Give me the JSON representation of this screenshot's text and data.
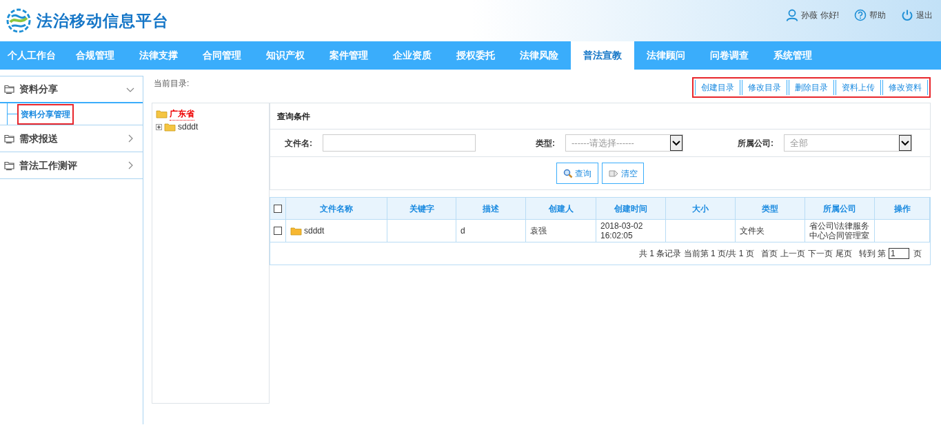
{
  "header": {
    "title": "法治移动信息平台",
    "user": "孙薇 你好!",
    "help": "帮助",
    "logout": "退出"
  },
  "nav": [
    {
      "label": "个人工作台",
      "selected": false
    },
    {
      "label": "合规管理",
      "selected": false
    },
    {
      "label": "法律支撑",
      "selected": false
    },
    {
      "label": "合同管理",
      "selected": false
    },
    {
      "label": "知识产权",
      "selected": false
    },
    {
      "label": "案件管理",
      "selected": false
    },
    {
      "label": "企业资质",
      "selected": false
    },
    {
      "label": "授权委托",
      "selected": false
    },
    {
      "label": "法律风险",
      "selected": false
    },
    {
      "label": "普法宣教",
      "selected": true
    },
    {
      "label": "法律顾问",
      "selected": false
    },
    {
      "label": "问卷调查",
      "selected": false
    },
    {
      "label": "系统管理",
      "selected": false
    }
  ],
  "sidebar": [
    {
      "label": "资料分享",
      "expanded": true,
      "children": [
        {
          "label": "资料分享管理",
          "selected": true,
          "highlighted": true
        }
      ]
    },
    {
      "label": "需求报送",
      "expanded": false
    },
    {
      "label": "普法工作测评",
      "expanded": false
    }
  ],
  "current_dir_label": "当前目录:",
  "tree": {
    "label": "广东省",
    "children": [
      {
        "label": "sdddt"
      }
    ]
  },
  "toolbar": {
    "highlighted": true,
    "buttons": [
      "创建目录",
      "修改目录",
      "删除目录",
      "资料上传",
      "修改资料"
    ]
  },
  "query": {
    "title": "查询条件",
    "fields": [
      {
        "kind": "text",
        "label": "文件名:"
      },
      {
        "kind": "select",
        "label": "类型:",
        "value": "------请选择------"
      },
      {
        "kind": "select",
        "label": "所属公司:",
        "value": "全部"
      }
    ],
    "search": "查询",
    "clear": "清空"
  },
  "table": {
    "columns": [
      "文件名称",
      "关键字",
      "描述",
      "创建人",
      "创建时间",
      "大小",
      "类型",
      "所属公司",
      "操作"
    ],
    "rows": [
      {
        "checked": false,
        "cells": [
          "sdddt",
          "",
          "d",
          "袁强",
          "2018-03-02 16:02:05",
          "",
          "文件夹",
          "省公司\\法律服务中心\\合同管理室",
          ""
        ]
      }
    ],
    "header_checked": false
  },
  "pager": {
    "summary": "共 1 条记录 当前第 1 页/共 1 页",
    "links": [
      "首页",
      "上一页",
      "下一页",
      "尾页"
    ],
    "goto": "转到 第",
    "page": "1",
    "unit": "页"
  }
}
